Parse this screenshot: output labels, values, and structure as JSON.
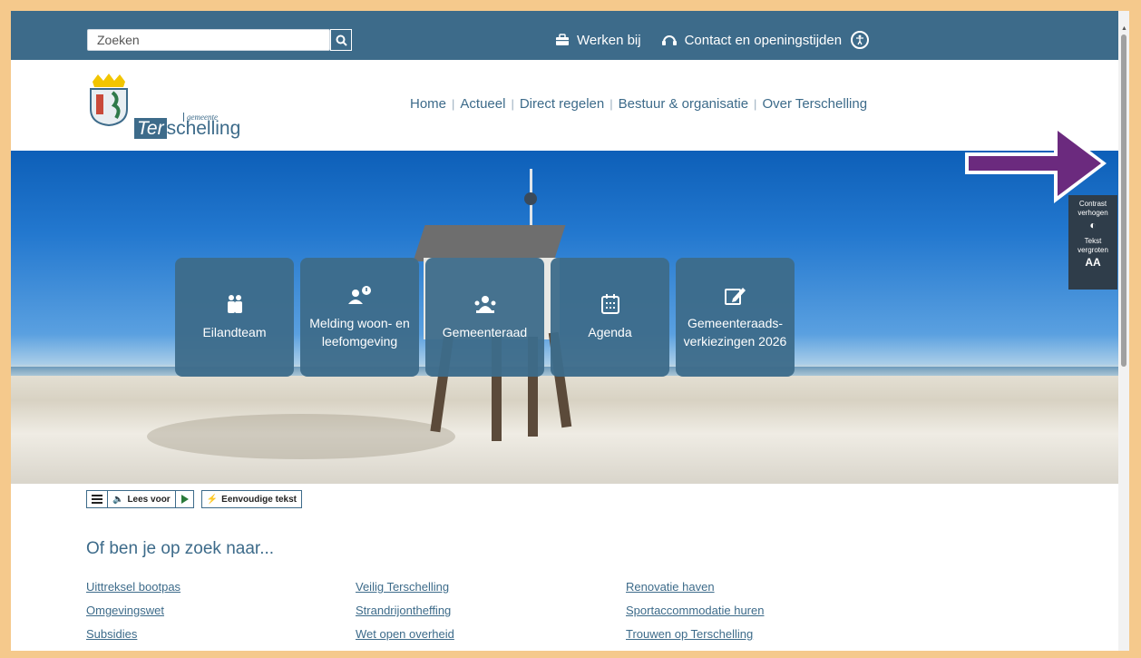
{
  "search": {
    "placeholder": "Zoeken"
  },
  "topbar": {
    "links": [
      {
        "label": "Werken bij",
        "icon": "briefcase-icon"
      },
      {
        "label": "Contact en openingstijden",
        "icon": "headset-icon"
      }
    ],
    "accessibility_icon": "accessibility-icon"
  },
  "logo": {
    "small": "gemeente",
    "ter": "Ter",
    "rest": "schelling"
  },
  "nav": {
    "items": [
      "Home",
      "Actueel",
      "Direct regelen",
      "Bestuur & organisatie",
      "Over Terschelling"
    ]
  },
  "tiles": [
    {
      "label": "Eilandteam",
      "icon": "team-icon"
    },
    {
      "label": "Melding woon- en leefomgeving",
      "icon": "report-icon"
    },
    {
      "label": "Gemeenteraad",
      "icon": "council-icon"
    },
    {
      "label": "Agenda",
      "icon": "calendar-icon"
    },
    {
      "label": "Gemeenteraads-verkiezingen 2026",
      "icon": "edit-icon"
    }
  ],
  "widget": {
    "contrast_label": "Contrast verhogen",
    "text_label": "Tekst vergroten",
    "text_glyph": "AA"
  },
  "readspeaker": {
    "read_label": "Lees voor",
    "simple_label": "Eenvoudige tekst"
  },
  "suggestions": {
    "title": "Of ben je op zoek naar...",
    "columns": [
      [
        "Uittreksel bootpas",
        "Omgevingswet",
        "Subsidies"
      ],
      [
        "Veilig Terschelling",
        "Strandrijontheffing",
        "Wet open overheid"
      ],
      [
        "Renovatie haven",
        "Sportaccommodatie huren",
        "Trouwen op Terschelling"
      ]
    ]
  },
  "colors": {
    "brand": "#3d6b8a",
    "frame": "#f5c98c",
    "arrow": "#6b2a7e"
  }
}
